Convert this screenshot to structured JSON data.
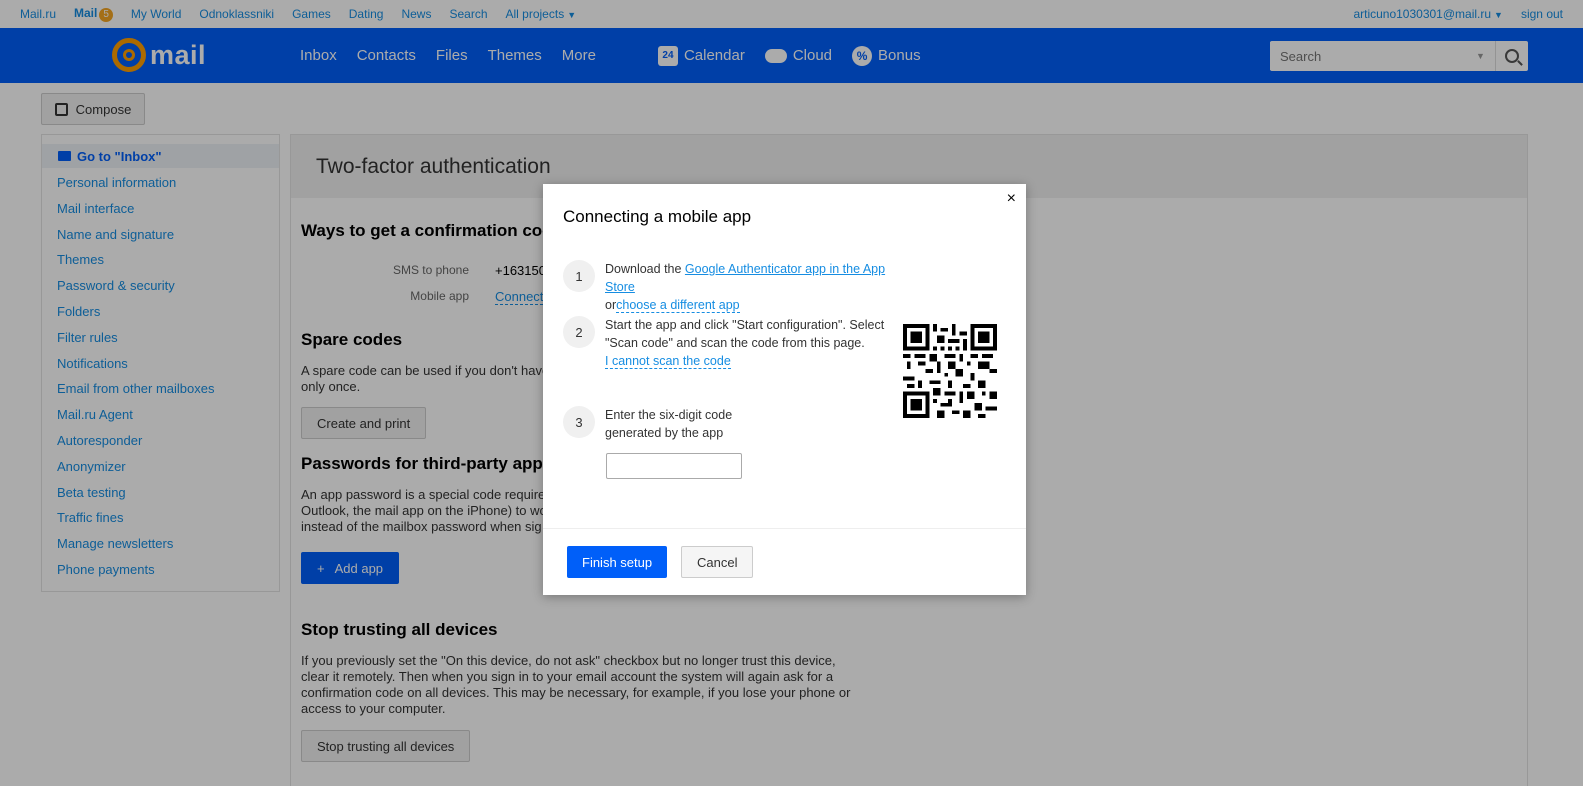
{
  "portal": {
    "links": [
      "Mail.ru",
      "Mail",
      "My World",
      "Odnoklassniki",
      "Games",
      "Dating",
      "News",
      "Search",
      "All projects"
    ],
    "mail_badge": "5",
    "user": "articuno1030301@mail.ru",
    "signout": "sign out"
  },
  "header": {
    "logo": "mail",
    "nav": [
      "Inbox",
      "Contacts",
      "Files",
      "Themes",
      "More"
    ],
    "calendar": "Calendar",
    "calendar_icon_text": "24",
    "cloud": "Cloud",
    "bonus": "Bonus",
    "search_placeholder": "Search"
  },
  "compose": "Compose",
  "sidebar": {
    "go_inbox": "Go to \"Inbox\"",
    "items": [
      "Personal information",
      "Mail interface",
      "Name and signature",
      "Themes",
      "Password & security",
      "Folders",
      "Filter rules",
      "Notifications",
      "Email from other mailboxes",
      "Mail.ru Agent",
      "Autoresponder",
      "Anonymizer",
      "Beta testing",
      "Traffic fines",
      "Manage newsletters",
      "Phone payments"
    ]
  },
  "main": {
    "title": "Two-factor authentication",
    "ways_heading": "Ways to get a confirmation coc",
    "sms_label": "SMS to phone",
    "sms_value": "+163150",
    "mobile_label": "Mobile app",
    "mobile_value": "Connect",
    "spare_heading": "Spare codes",
    "spare_text_1": "A spare code can be used if you don't have",
    "spare_text_2": "only once.",
    "create_print": "Create and print",
    "passwords_heading": "Passwords for third-party apps",
    "passwords_text_1": "An app password is a special code require",
    "passwords_text_2": "Outlook, the mail app on the iPhone) to wo",
    "passwords_text_3": "instead of the mailbox password when sig",
    "add_app": "Add app",
    "stop_heading": "Stop trusting all devices",
    "stop_text": "If you previously set the \"On this device, do not ask\" checkbox but no longer trust this device, clear it remotely. Then when you sign in to your email account the system will again ask for a confirmation code on all devices. This may be necessary, for example, if you lose your phone or access to your computer.",
    "stop_button": "Stop trusting all devices"
  },
  "modal": {
    "title": "Connecting a mobile app",
    "close": "×",
    "step1_num": "1",
    "step1_prefix": "Download the ",
    "step1_link": "Google Authenticator app in the App Store",
    "step1_or": "or",
    "step1_alt": "choose a different app",
    "step2_num": "2",
    "step2_text": "Start the app and click \"Start configuration\". Select \"Scan code\" and scan the code from this page.",
    "step2_link": "I cannot scan the code",
    "step3_num": "3",
    "step3_text": "Enter the six-digit code generated by the app",
    "finish": "Finish setup",
    "cancel": "Cancel"
  }
}
